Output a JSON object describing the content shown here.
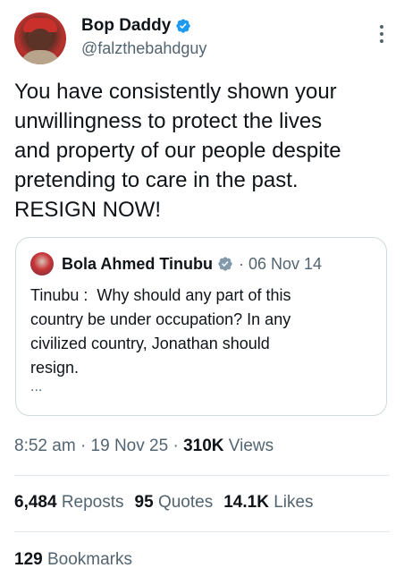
{
  "author": {
    "display_name": "Bop Daddy",
    "handle": "@falzthebahdguy",
    "avatar_icon": "profile-avatar",
    "verified_icon": "verified-badge-icon",
    "verified_color": "#1d9bf0"
  },
  "tweet": {
    "text": "You have consistently shown your\nunwillingness to protect the lives\nand property of our people despite\npretending to care in the past.\nRESIGN NOW!"
  },
  "quoted_tweet": {
    "display_name": "Bola Ahmed Tinubu",
    "separator": "·",
    "date": "06 Nov 14",
    "verified_icon": "verified-badge-gray-icon",
    "verified_color": "#829aab",
    "text": "Tinubu :  Why should any part of this\ncountry be under occupation? In any\ncivilized country, Jonathan should\nresign.",
    "ellipsis": "..."
  },
  "meta": {
    "time": "8:52 am",
    "dot1": "·",
    "date": "19 Nov 25",
    "dot2": "·",
    "views_count": "310K",
    "views_label": "Views"
  },
  "stats": {
    "reposts_count": "6,484",
    "reposts_label": "Reposts",
    "quotes_count": "95",
    "quotes_label": "Quotes",
    "likes_count": "14.1K",
    "likes_label": "Likes",
    "bookmarks_count": "129",
    "bookmarks_label": "Bookmarks"
  },
  "colors": {
    "text_primary": "#0f1419",
    "text_secondary": "#536471",
    "border": "#cfd9de"
  }
}
